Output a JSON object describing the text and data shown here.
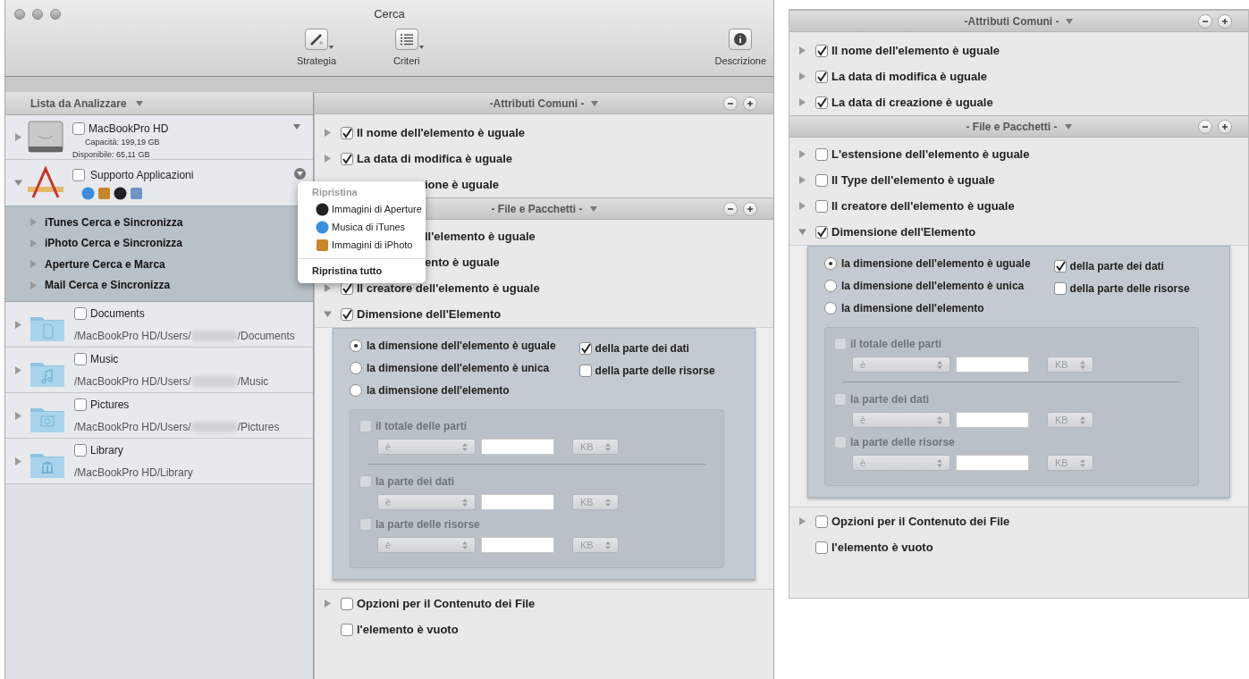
{
  "window": {
    "title": "Cerca",
    "toolbar": [
      {
        "label": "Strategia",
        "has_menu": true
      },
      {
        "label": "Criteri",
        "has_menu": true
      },
      {
        "label": "Descrizione",
        "has_menu": false
      }
    ]
  },
  "sidebar": {
    "header": "Lista da Analizzare",
    "drive": {
      "name": "MacBookPro HD",
      "checked": false,
      "expanded": false,
      "capacity": "Capacità: 199,19 GB",
      "available": "Disponibile: 65,11 GB"
    },
    "bundle": {
      "name": "Supporto Applicazioni",
      "checked": false,
      "expanded": true,
      "children": [
        {
          "text": "iTunes Cerca e Sincronizza",
          "expanded": false
        },
        {
          "text": "iPhoto Cerca e Sincronizza",
          "expanded": false
        },
        {
          "text": "Aperture Cerca e Marca",
          "expanded": false
        },
        {
          "text": "Mail Cerca e Sincronizza",
          "expanded": false
        }
      ]
    },
    "folders": [
      {
        "name": "Documents",
        "checked": false,
        "expanded": false,
        "path": "/MacBookPro HD/Users/",
        "path_end": "/Documents",
        "redacted": true
      },
      {
        "name": "Music",
        "checked": false,
        "expanded": false,
        "path": "/MacBookPro HD/Users/",
        "path_end": "/Music",
        "redacted": true
      },
      {
        "name": "Pictures",
        "checked": false,
        "expanded": false,
        "path": "/MacBookPro HD/Users/",
        "path_end": "/Pictures",
        "redacted": true
      },
      {
        "name": "Library",
        "checked": false,
        "expanded": false,
        "path": "/MacBookPro HD/Library",
        "redacted": false
      }
    ]
  },
  "popup_menu": {
    "title": "Ripristina",
    "items": [
      {
        "text": "Immagini di Aperture"
      },
      {
        "text": "Musica di iTunes"
      },
      {
        "text": "Immagini di iPhoto"
      }
    ],
    "footer": "Ripristina tutto"
  },
  "criteria_panels": [
    {
      "sections": [
        {
          "title": "-Attributi Comuni -",
          "rows": [
            {
              "kind": "disclosure",
              "text": "Il nome dell'elemento è uguale",
              "checked": true,
              "expanded": false
            },
            {
              "kind": "disclosure",
              "text": "La data di modifica è uguale",
              "checked": true,
              "expanded": false
            },
            {
              "kind": "partial",
              "text": "ione è uguale"
            }
          ]
        },
        {
          "title": "- File e Pacchetti -",
          "rows": [
            {
              "kind": "partial",
              "text": "ll'elemento è uguale"
            },
            {
              "kind": "partial",
              "text": "ento è uguale"
            },
            {
              "kind": "disclosure",
              "text": "Il creatore dell'elemento è uguale",
              "checked": true,
              "expanded": false
            },
            {
              "kind": "disclosure",
              "text": "Dimensione dell'Elemento",
              "checked": true,
              "expanded": true
            }
          ]
        }
      ],
      "size_options": {
        "radios": [
          {
            "text": "la dimensione dell'elemento è uguale",
            "selected": true
          },
          {
            "text": "la dimensione dell'elemento è unica",
            "selected": false
          },
          {
            "text": "la dimensione dell'elemento",
            "selected": false
          }
        ],
        "checks": [
          {
            "text": "della parte dei dati",
            "checked": true
          },
          {
            "text": "della parte delle risorse",
            "checked": false
          }
        ],
        "disabled": true,
        "groups": [
          {
            "label": "il totale delle parti",
            "checked": false,
            "operator": "è",
            "unit": "KB"
          },
          {
            "label": "la parte dei dati",
            "checked": false,
            "operator": "è",
            "unit": "KB"
          },
          {
            "label": "la parte delle risorse",
            "checked": false,
            "operator": "è",
            "unit": "KB"
          }
        ]
      },
      "bottom_rows": [
        {
          "kind": "disclosure",
          "text": "Opzioni per il Contenuto dei File",
          "checked": false,
          "expanded": false
        },
        {
          "kind": "plain",
          "text": "l'elemento è vuoto",
          "checked": false
        }
      ]
    },
    {
      "sections": [
        {
          "title": "-Attributi Comuni -",
          "rows": [
            {
              "kind": "disclosure",
              "text": "Il nome dell'elemento è uguale",
              "checked": true,
              "expanded": false
            },
            {
              "kind": "disclosure",
              "text": "La data di modifica è uguale",
              "checked": true,
              "expanded": false
            },
            {
              "kind": "disclosure",
              "text": "La data di creazione è uguale",
              "checked": true,
              "expanded": false
            }
          ]
        },
        {
          "title": "- File e Pacchetti -",
          "rows": [
            {
              "kind": "disclosure",
              "text": "L'estensione dell'elemento è uguale",
              "checked": false,
              "expanded": false
            },
            {
              "kind": "disclosure",
              "text": "Il Type dell'elemento è uguale",
              "checked": false,
              "expanded": false
            },
            {
              "kind": "disclosure",
              "text": "Il creatore dell'elemento è uguale",
              "checked": false,
              "expanded": false
            },
            {
              "kind": "disclosure",
              "text": "Dimensione dell'Elemento",
              "checked": true,
              "expanded": true
            }
          ]
        }
      ],
      "size_options": {
        "radios": [
          {
            "text": "la dimensione dell'elemento è uguale",
            "selected": true
          },
          {
            "text": "la dimensione dell'elemento è unica",
            "selected": false
          },
          {
            "text": "la dimensione dell'elemento",
            "selected": false
          }
        ],
        "checks": [
          {
            "text": "della parte dei dati",
            "checked": true
          },
          {
            "text": "della parte delle risorse",
            "checked": false
          }
        ],
        "disabled": true,
        "groups": [
          {
            "label": "il totale delle parti",
            "checked": false,
            "operator": "è",
            "unit": "KB"
          },
          {
            "label": "la parte dei dati",
            "checked": false,
            "operator": "è",
            "unit": "KB"
          },
          {
            "label": "la parte delle risorse",
            "checked": false,
            "operator": "è",
            "unit": "KB"
          }
        ]
      },
      "bottom_rows": [
        {
          "kind": "disclosure",
          "text": "Opzioni per il Contenuto dei File",
          "checked": false,
          "expanded": false
        },
        {
          "kind": "plain",
          "text": "l'elemento è vuoto",
          "checked": false
        }
      ]
    }
  ]
}
